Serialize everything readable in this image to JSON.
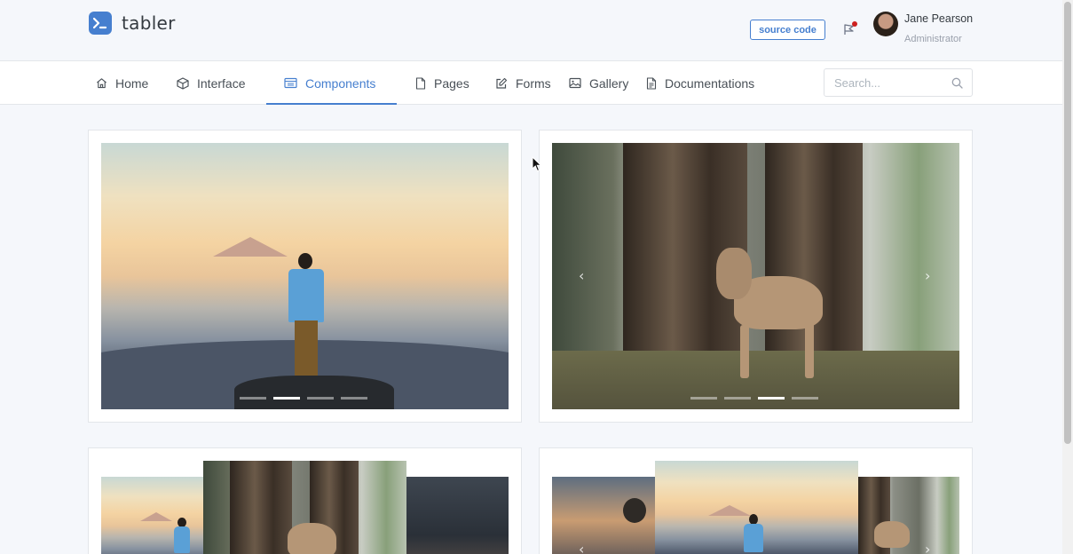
{
  "brand": {
    "name": "tabler",
    "accent": "#467fcf"
  },
  "header": {
    "source_code_label": "source code",
    "notification_icon": "flag-icon",
    "user": {
      "name": "Jane Pearson",
      "role": "Administrator"
    }
  },
  "nav": {
    "items": [
      {
        "label": "Home",
        "icon": "home-icon"
      },
      {
        "label": "Interface",
        "icon": "box-icon"
      },
      {
        "label": "Components",
        "icon": "calendar-icon",
        "active": true
      },
      {
        "label": "Pages",
        "icon": "file-icon"
      },
      {
        "label": "Forms",
        "icon": "edit-icon"
      },
      {
        "label": "Gallery",
        "icon": "image-icon"
      },
      {
        "label": "Documentations",
        "icon": "file-text-icon"
      }
    ],
    "search_placeholder": "Search..."
  },
  "carousels": [
    {
      "variant": "indicators",
      "indicator_count": 4,
      "active_slide": 2
    },
    {
      "variant": "controls-and-indicators",
      "indicator_count": 4,
      "active_slide": 3,
      "prev": "‹",
      "next": "›"
    },
    {
      "variant": "sliding"
    },
    {
      "variant": "sliding-controls",
      "prev": "‹",
      "next": "›"
    }
  ]
}
